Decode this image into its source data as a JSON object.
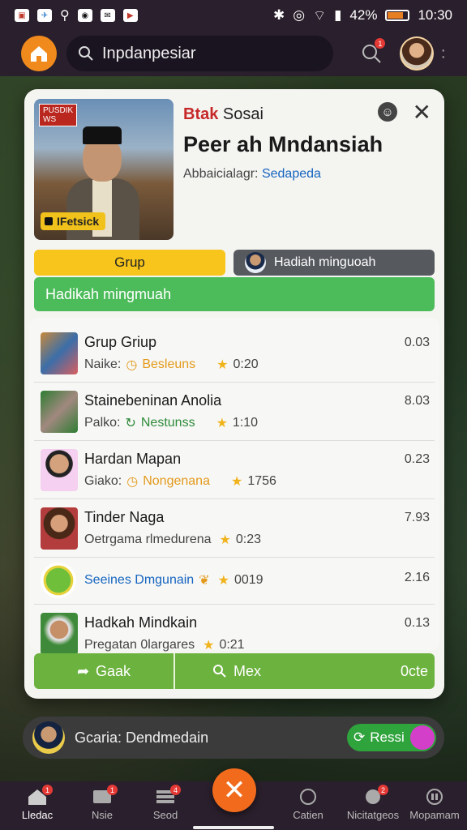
{
  "status_bar": {
    "time": "10:30",
    "battery": "42%",
    "icons": [
      "bluetooth-icon",
      "nfc-icon",
      "wifi-icon",
      "signal-icon"
    ]
  },
  "top_bar": {
    "search_value": "Inpdanpesiar",
    "notification_count": "1"
  },
  "card": {
    "hero_tag": "PUSDIK\nWS",
    "hero_chip": "IFetsick",
    "brand_part1": "Btak",
    "brand_part2": "Sosai",
    "title": "Peer ah Mndansiah",
    "subtitle_label": "Abbaicialagr:",
    "subtitle_link": "Sedapeda",
    "tab_grup": "Grup",
    "tab_hadiah": "Hadiah minguoah",
    "banner": "Hadikah mingmuah"
  },
  "list": [
    {
      "title": "Grup Griup",
      "label": "Naike:",
      "status": "Besleuns",
      "status_color": "#e39a1b",
      "time": "0:20",
      "value": "0.03"
    },
    {
      "title": "Stainebeninan Anolia",
      "label": "Palko:",
      "status": "Nestunss",
      "status_color": "#2e8b3a",
      "time": "1:10",
      "value": "8.03"
    },
    {
      "title": "Hardan Mapan",
      "label": "Giako:",
      "status": "Nongenana",
      "status_color": "#e39a1b",
      "time": "1756",
      "value": "0.23"
    },
    {
      "title": "Tinder Naga",
      "label": "Oetrgama rlmedurena",
      "status": "",
      "status_color": "#444444",
      "time": "0:23",
      "value": "7.93"
    },
    {
      "title": "",
      "label": "Seeines Dmgunain",
      "status": "",
      "status_color": "#1565c0",
      "time": "0019",
      "value": "2.16"
    },
    {
      "title": "Hadkah Mindkain",
      "label": "Pregatan 0largares",
      "status": "",
      "status_color": "#444444",
      "time": "0:21",
      "value": "0.13"
    }
  ],
  "actions": {
    "share": "Gaak",
    "search": "Mex",
    "more": "0cte"
  },
  "notification": {
    "text": "Gcaria: Dendmedain",
    "button": "Ressi"
  },
  "bottom_nav": [
    {
      "label": "Lledac",
      "badge": "1"
    },
    {
      "label": "Nsie",
      "badge": "1"
    },
    {
      "label": "Seod",
      "badge": "4"
    },
    {
      "label": "Catien",
      "badge": ""
    },
    {
      "label": "Nicitatgeos",
      "badge": "2"
    },
    {
      "label": "Mopamam",
      "badge": ""
    }
  ]
}
